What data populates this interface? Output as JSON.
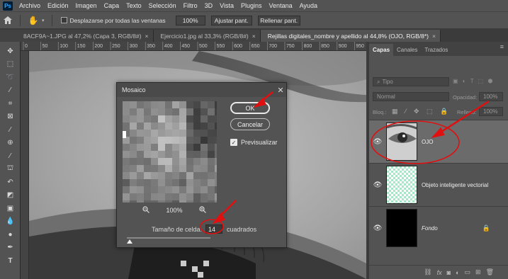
{
  "menubar": {
    "logo": "Ps",
    "items": [
      "Archivo",
      "Edición",
      "Imagen",
      "Capa",
      "Texto",
      "Selección",
      "Filtro",
      "3D",
      "Vista",
      "Plugins",
      "Ventana",
      "Ayuda"
    ]
  },
  "options": {
    "scroll_all_label": "Desplazarse por todas las ventanas",
    "zoom_value": "100%",
    "fit_button": "Ajustar pant.",
    "fill_button": "Rellenar pant."
  },
  "tabs": [
    {
      "label": "8ACF9A~1.JPG al 47,2% (Capa 3, RGB/8#)",
      "close": "×"
    },
    {
      "label": "Ejercicio1.jpg al 33,3% (RGB/8#)",
      "close": "×"
    },
    {
      "label": "Rejillas digitales_nombre y apellido al 44,8% (OJO, RGB/8*)",
      "close": "×"
    }
  ],
  "ruler_labels": [
    "0",
    "50",
    "100",
    "150",
    "200",
    "250",
    "300",
    "350",
    "400",
    "450",
    "500",
    "550",
    "600",
    "650",
    "700",
    "750",
    "800",
    "850",
    "900",
    "950"
  ],
  "dialog": {
    "title": "Mosaico",
    "close": "✕",
    "ok_label": "OK",
    "cancel_label": "Cancelar",
    "preview_label": "Previsualizar",
    "zoom_out": "−",
    "zoom_value": "100%",
    "zoom_in": "+",
    "cell_size_label": "Tamaño de celda:",
    "cell_size_value": "14",
    "cell_size_unit": "cuadrados"
  },
  "layers_panel": {
    "tabs": [
      "Capas",
      "Canales",
      "Trazados"
    ],
    "filter_placeholder": "Tipo",
    "blend_mode": "Normal",
    "opacity_label": "Opacidad:",
    "opacity_value": "100%",
    "lock_label": "Bloq.:",
    "fill_label": "Relleno:",
    "fill_value": "100%",
    "layers": [
      {
        "name": "OJO",
        "selected": true
      },
      {
        "name": "Objeto inteligente vectorial",
        "selected": false
      },
      {
        "name": "Fondo",
        "selected": false
      }
    ]
  },
  "colors": {
    "annotation_red": "#e01010",
    "panel_bg": "#535353",
    "selected_layer": "#6b6b6b"
  }
}
